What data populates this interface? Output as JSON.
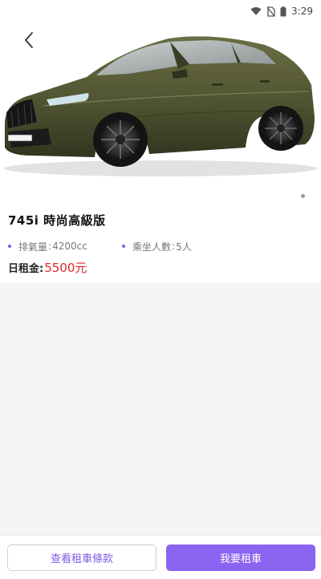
{
  "status_bar": {
    "time": "3:29",
    "icons": [
      "wifi-icon",
      "no-sim-icon",
      "battery-icon"
    ]
  },
  "header": {
    "back_icon": "chevron-left-icon"
  },
  "gallery": {
    "image": "car-photo",
    "page_indicator": {
      "current": 1,
      "total": 1
    }
  },
  "car": {
    "title": "745i 時尚高級版",
    "specs": [
      {
        "label": "排氣量",
        "value": "4200cc"
      },
      {
        "label": "乘坐人數",
        "value": "5人"
      }
    ],
    "price_label": "日租金:",
    "price_value": "5500元"
  },
  "actions": {
    "terms_label": "查看租車條款",
    "rent_label": "我要租車"
  },
  "colors": {
    "accent": "#8a63f0",
    "price": "#e3262b",
    "car_body": "#4f5331"
  }
}
